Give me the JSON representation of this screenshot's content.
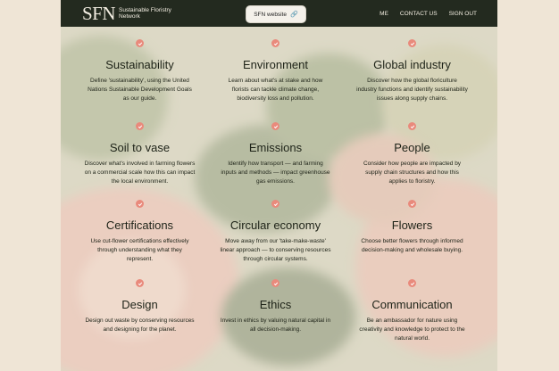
{
  "header": {
    "logo_mark": "SFN",
    "logo_text": "Sustainable Floristry Network",
    "website_button": "SFN website",
    "nav": [
      "ME",
      "CONTACT US",
      "SIGN OUT"
    ]
  },
  "colors": {
    "topbar": "#232a1f",
    "check": "#e98a7c",
    "page_bg": "#efe5d6"
  },
  "topics": [
    {
      "title": "Sustainability",
      "text": "Define 'sustainability', using the United Nations Sustainable Development Goals as our guide."
    },
    {
      "title": "Environment",
      "text": "Learn about what's at stake and how florists can tackle climate change, biodiversity loss and pollution."
    },
    {
      "title": "Global industry",
      "text": "Discover how the global floriculture industry functions and identify sustainability issues along supply chains."
    },
    {
      "title": "Soil to vase",
      "text": "Discover what's involved in farming flowers on a commercial scale how this can impact the local environment."
    },
    {
      "title": "Emissions",
      "text": "Identify how transport — and farming inputs and methods — impact greenhouse gas emissions."
    },
    {
      "title": "People",
      "text": "Consider how people are impacted by supply chain structures and how this applies to floristry."
    },
    {
      "title": "Certifications",
      "text": "Use cut-flower certifications effectively through understanding what they represent."
    },
    {
      "title": "Circular economy",
      "text": "Move away from our 'take-make-waste' linear approach — to conserving resources through circular systems."
    },
    {
      "title": "Flowers",
      "text": "Choose better flowers through informed decision-making and wholesale buying."
    },
    {
      "title": "Design",
      "text": "Design out waste by conserving resources and designing for the planet."
    },
    {
      "title": "Ethics",
      "text": "Invest in ethics by valuing natural capital in all decision-making."
    },
    {
      "title": "Communication",
      "text": "Be an ambassador for nature using creativity and knowledge to protect to the natural world."
    }
  ]
}
